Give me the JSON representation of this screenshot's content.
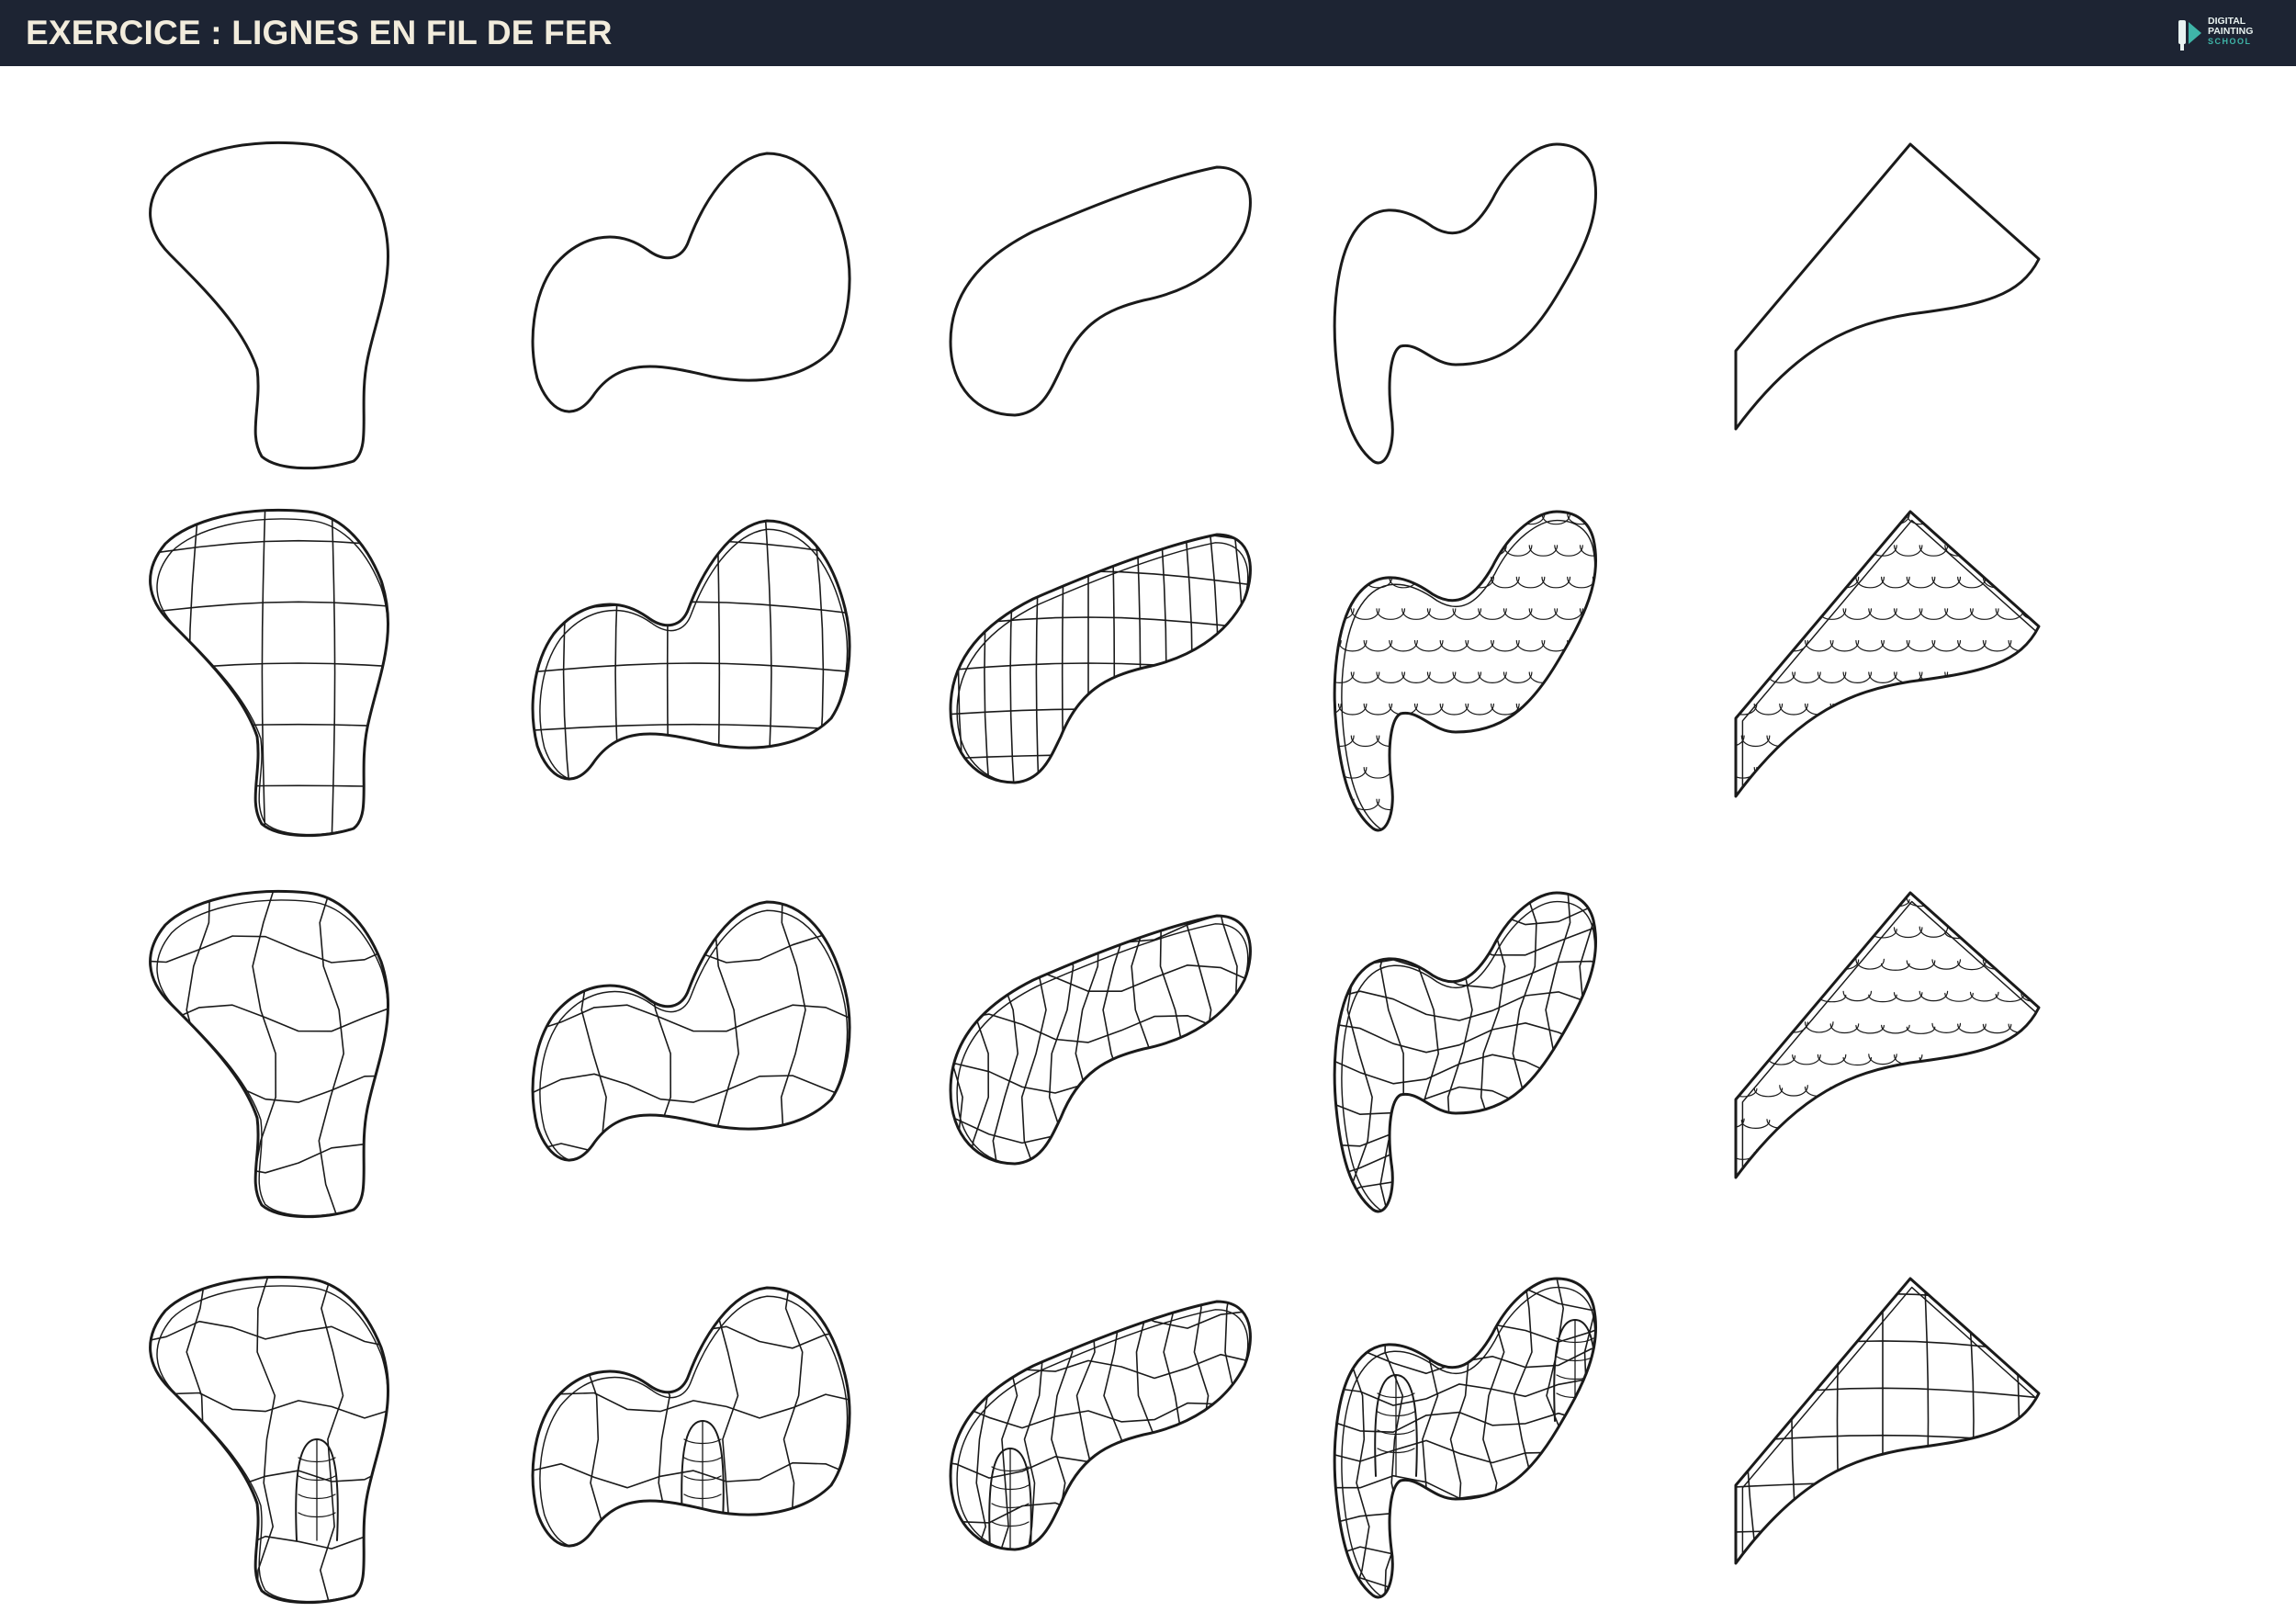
{
  "header": {
    "title": "EXERCICE : LIGNES EN FIL DE FER",
    "logo": {
      "line1": "DIGITAL",
      "line2": "PAINTING",
      "line3": "SCHOOL",
      "icon": "paintbrush-play-icon",
      "accent_color": "#3fb5a8"
    },
    "background_color": "#1d2433",
    "title_color": "#f2ecdc"
  },
  "sheet": {
    "columns": 5,
    "rows": 4,
    "row_styles": [
      "outline",
      "regular-grid",
      "wavy-grid",
      "grid-with-bumps"
    ],
    "stroke_color": "#1a1a1a"
  }
}
